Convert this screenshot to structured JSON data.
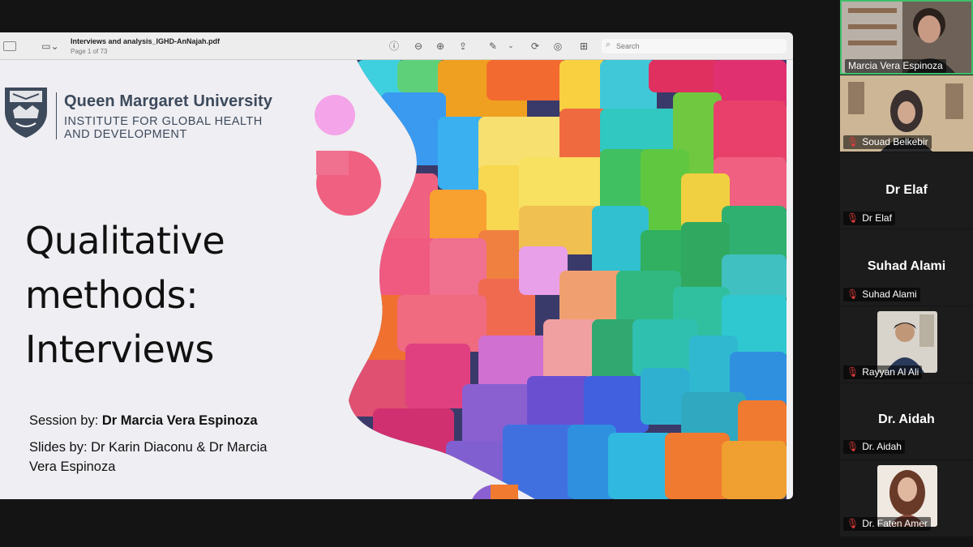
{
  "viewer": {
    "doc_title": "Interviews and analysis_IGHD-AnNajah.pdf",
    "page_info": "Page 1 of 73",
    "search_placeholder": "Search",
    "icons": [
      "sidebar-icon",
      "info-icon",
      "zoom-out-icon",
      "zoom-in-icon",
      "share-icon",
      "markup-icon",
      "rotate-icon",
      "highlight-icon",
      "form-icon",
      "search-icon"
    ]
  },
  "slide": {
    "university": "Queen Margaret University",
    "institute_line1": "INSTITUTE FOR GLOBAL HEALTH",
    "institute_line2": "AND DEVELOPMENT",
    "title_lines": [
      "Qualitative",
      "methods:",
      "Interviews"
    ],
    "session_label": "Session by: ",
    "session_name": "Dr Marcia Vera Espinoza",
    "slides_line1": "Slides by: Dr Karin Diaconu & Dr Marcia",
    "slides_line2": "Vera Espinoza"
  },
  "participants": {
    "p1": {
      "name": "Marcia Vera Espinoza",
      "active_color": "#3fbf6a"
    },
    "p2": {
      "name": "Souad Belkebir"
    },
    "p3": {
      "display": "Dr Elaf",
      "name": "Dr Elaf"
    },
    "p4": {
      "display": "Suhad Alami",
      "name": "Suhad Alami"
    },
    "p5": {
      "name": "Rayyan Al Ali"
    },
    "p6": {
      "display": "Dr. Aidah",
      "name": "Dr. Aidah"
    },
    "p7": {
      "name": "Dr. Faten Amer"
    },
    "muted_icon": "mic-muted-icon"
  }
}
